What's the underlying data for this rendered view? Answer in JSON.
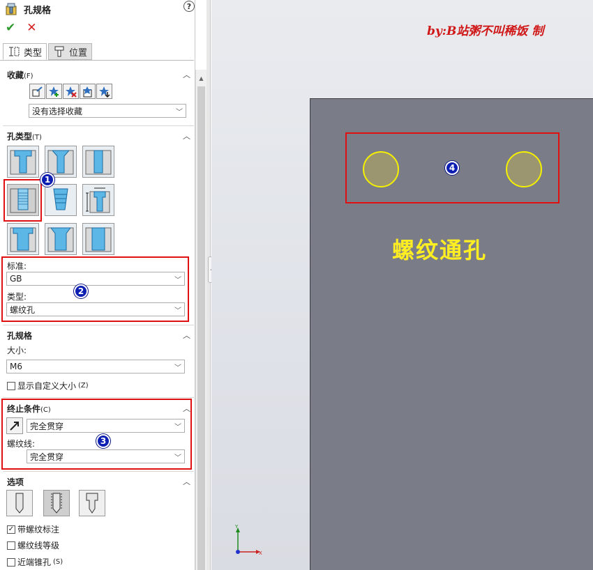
{
  "panel": {
    "title": "孔规格",
    "help": "?",
    "ok": "✔",
    "cancel": "✕",
    "tabs": [
      {
        "label": "类型"
      },
      {
        "label": "位置"
      }
    ],
    "favorites": {
      "title": "收藏",
      "shortcut": "(F)",
      "selection": "没有选择收藏"
    },
    "hole_type": {
      "title": "孔类型",
      "shortcut": "(T)",
      "standard_label": "标准:",
      "standard_value": "GB",
      "type_label": "类型:",
      "type_value": "螺纹孔"
    },
    "hole_spec": {
      "title": "孔规格",
      "size_label": "大小:",
      "size_value": "M6",
      "custom_size_label": "显示自定义大小",
      "custom_size_shortcut": "(Z)"
    },
    "end_condition": {
      "title": "终止条件",
      "shortcut": "(C)",
      "value": "完全贯穿",
      "thread_label": "螺纹线:",
      "thread_value": "完全贯穿"
    },
    "options": {
      "title": "选项",
      "with_thread_callout": "带螺纹标注",
      "thread_class": "螺纹线等级",
      "near_side_countersink": "近端锥孔",
      "near_side_shortcut": "(S)"
    }
  },
  "badges": [
    "1",
    "2",
    "3",
    "4"
  ],
  "viewport": {
    "watermark": "by:B站粥不叫稀饭 制",
    "label": "螺纹通孔",
    "triad_y": "Y",
    "triad_x": "X"
  },
  "colors": {
    "part_face": "#7a7d87",
    "hole_outline": "#f5f000",
    "highlight_box": "#e01010",
    "badge": "#0d1fb3",
    "label_text": "#ffee22"
  }
}
